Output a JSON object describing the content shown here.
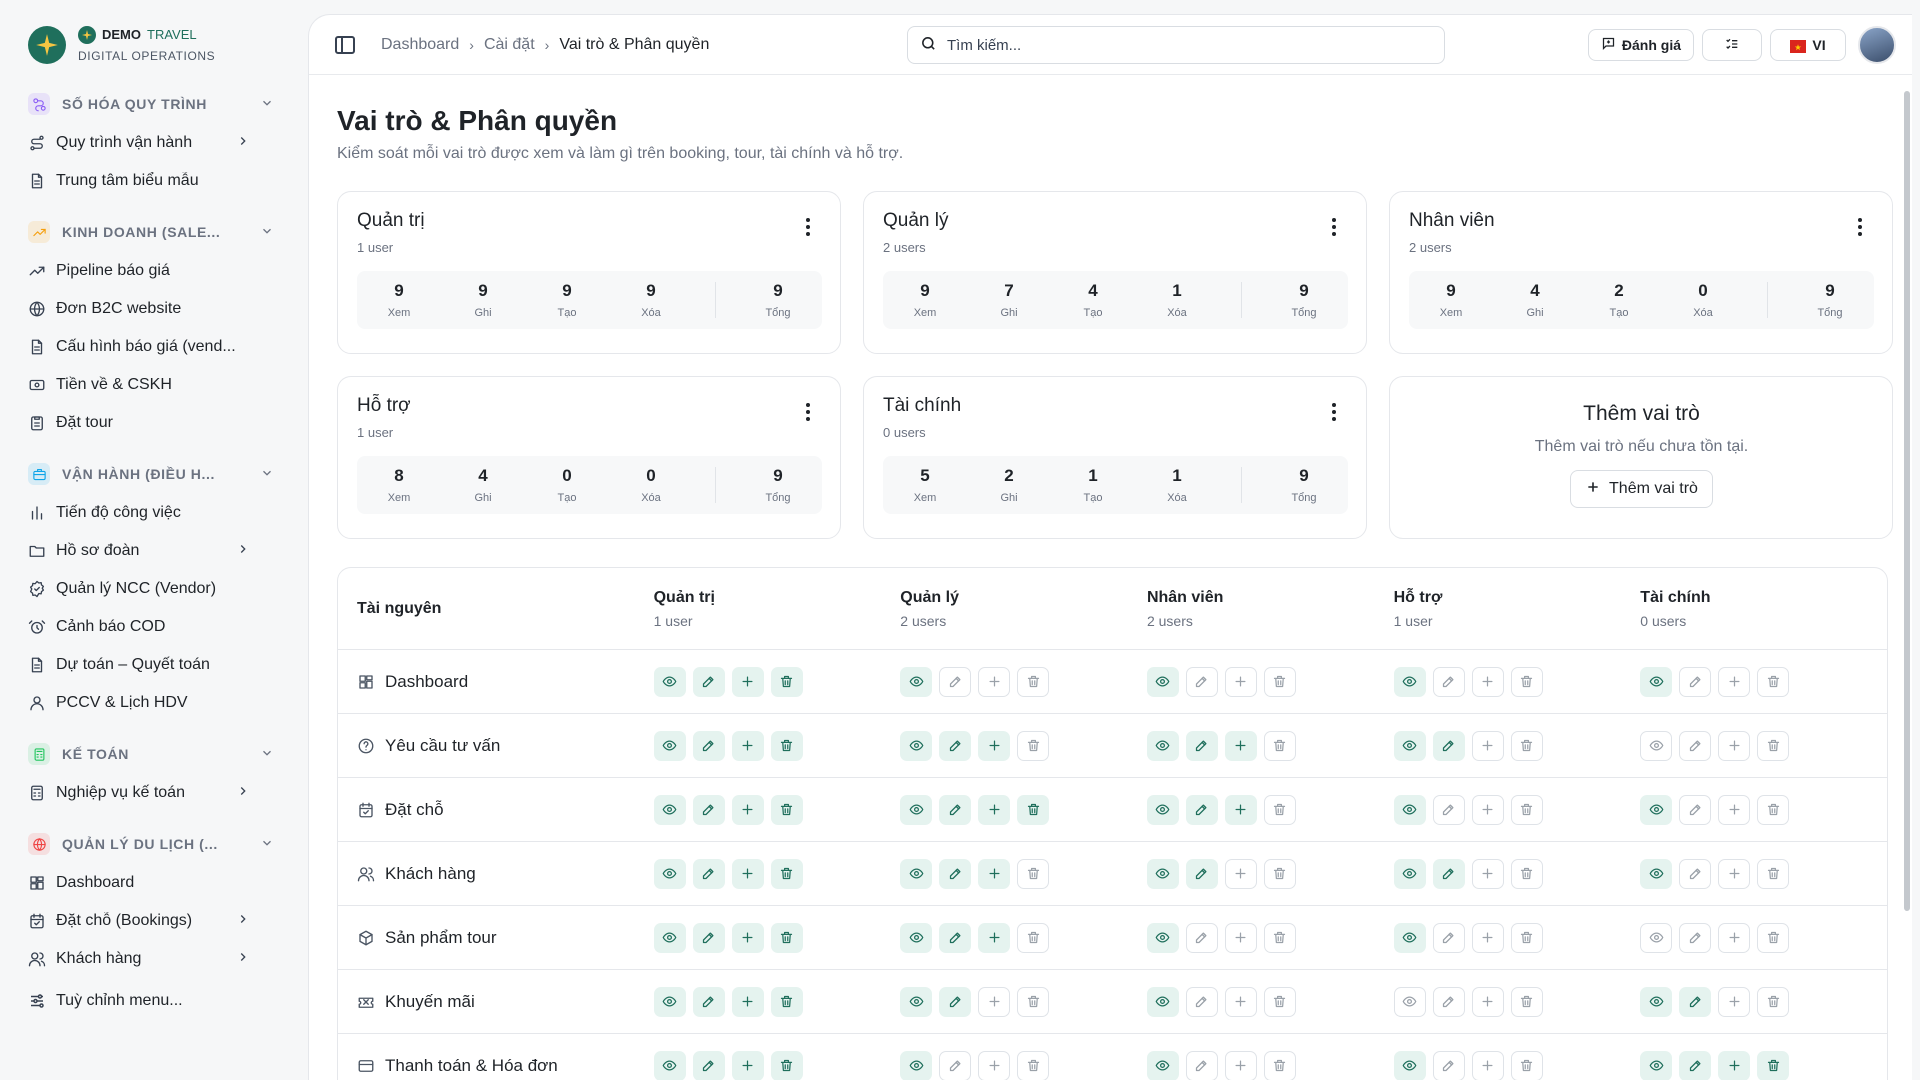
{
  "brand": {
    "name_bold": "DEMO",
    "name_light": "TRAVEL",
    "subtitle": "DIGITAL OPERATIONS"
  },
  "sidebar": {
    "sections": [
      {
        "label": "SỐ HÓA QUY TRÌNH",
        "icon": "workflow-icon",
        "color": "#8b5cf6",
        "items": [
          {
            "label": "Quy trình vận hành",
            "icon": "route-icon",
            "has_children": true
          },
          {
            "label": "Trung tâm biểu mẫu",
            "icon": "document-icon",
            "has_children": false
          }
        ]
      },
      {
        "label": "KINH DOANH (SALE...",
        "icon": "trend-icon",
        "color": "#f59e0b",
        "items": [
          {
            "label": "Pipeline báo giá",
            "icon": "trend-icon",
            "has_children": false
          },
          {
            "label": "Đơn B2C website",
            "icon": "globe-icon",
            "has_children": false
          },
          {
            "label": "Cấu hình báo giá (vend...",
            "icon": "document-icon",
            "has_children": false
          },
          {
            "label": "Tiền về & CSKH",
            "icon": "cash-icon",
            "has_children": false
          },
          {
            "label": "Đặt tour",
            "icon": "clipboard-icon",
            "has_children": false
          }
        ]
      },
      {
        "label": "VẬN HÀNH (ĐIỀU H...",
        "icon": "briefcase-icon",
        "color": "#0ea5e9",
        "items": [
          {
            "label": "Tiến độ công việc",
            "icon": "bars-icon",
            "has_children": false
          },
          {
            "label": "Hồ sơ đoàn",
            "icon": "folder-icon",
            "has_children": true
          },
          {
            "label": "Quản lý NCC (Vendor)",
            "icon": "badge-icon",
            "has_children": false
          },
          {
            "label": "Cảnh báo COD",
            "icon": "alarm-icon",
            "has_children": false
          },
          {
            "label": "Dự toán – Quyết toán",
            "icon": "document-icon",
            "has_children": false
          },
          {
            "label": "PCCV & Lịch HDV",
            "icon": "user-icon",
            "has_children": false
          }
        ]
      },
      {
        "label": "KẾ TOÁN",
        "icon": "calculator-icon",
        "color": "#22c55e",
        "items": [
          {
            "label": "Nghiệp vụ kế toán",
            "icon": "calculator-icon",
            "has_children": true
          }
        ]
      },
      {
        "label": "QUẢN LÝ DU LỊCH (...",
        "icon": "globe-icon",
        "color": "#ef4444",
        "items": [
          {
            "label": "Dashboard",
            "icon": "grid-icon",
            "has_children": false
          },
          {
            "label": "Đặt chỗ (Bookings)",
            "icon": "calendar-icon",
            "has_children": true
          },
          {
            "label": "Khách hàng",
            "icon": "users-icon",
            "has_children": true
          }
        ]
      }
    ],
    "customize_label": "Tuỳ chỉnh menu..."
  },
  "topbar": {
    "breadcrumb": [
      "Dashboard",
      "Cài đặt",
      "Vai trò & Phân quyền"
    ],
    "search_placeholder": "Tìm kiếm...",
    "feedback_label": "Đánh giá",
    "language_label": "VI"
  },
  "page": {
    "title": "Vai trò & Phân quyền",
    "subtitle": "Kiểm soát mỗi vai trò được xem và làm gì trên booking, tour, tài chính và hỗ trợ."
  },
  "stat_labels": [
    "Xem",
    "Ghi",
    "Tạo",
    "Xóa",
    "Tổng"
  ],
  "roles": [
    {
      "name": "Quản trị",
      "users": "1 user",
      "stats": [
        9,
        9,
        9,
        9
      ],
      "total": 9
    },
    {
      "name": "Quản lý",
      "users": "2 users",
      "stats": [
        9,
        7,
        4,
        1
      ],
      "total": 9
    },
    {
      "name": "Nhân viên",
      "users": "2 users",
      "stats": [
        9,
        4,
        2,
        0
      ],
      "total": 9
    },
    {
      "name": "Hỗ trợ",
      "users": "1 user",
      "stats": [
        8,
        4,
        0,
        0
      ],
      "total": 9
    },
    {
      "name": "Tài chính",
      "users": "0 users",
      "stats": [
        5,
        2,
        1,
        1
      ],
      "total": 9
    }
  ],
  "add_role": {
    "title": "Thêm vai trò",
    "description": "Thêm vai trò nếu chưa tồn tại.",
    "button": "Thêm vai trò"
  },
  "table": {
    "resource_header": "Tài nguyên",
    "rows": [
      {
        "resource": "Dashboard",
        "icon": "grid-icon",
        "perms": [
          [
            1,
            1,
            1,
            1
          ],
          [
            1,
            0,
            0,
            0
          ],
          [
            1,
            0,
            0,
            0
          ],
          [
            1,
            0,
            0,
            0
          ],
          [
            1,
            0,
            0,
            0
          ]
        ]
      },
      {
        "resource": "Yêu cầu tư vấn",
        "icon": "help-icon",
        "perms": [
          [
            1,
            1,
            1,
            1
          ],
          [
            1,
            1,
            1,
            0
          ],
          [
            1,
            1,
            1,
            0
          ],
          [
            1,
            1,
            0,
            0
          ],
          [
            0,
            0,
            0,
            0
          ]
        ]
      },
      {
        "resource": "Đặt chỗ",
        "icon": "calendar-icon",
        "perms": [
          [
            1,
            1,
            1,
            1
          ],
          [
            1,
            1,
            1,
            1
          ],
          [
            1,
            1,
            1,
            0
          ],
          [
            1,
            0,
            0,
            0
          ],
          [
            1,
            0,
            0,
            0
          ]
        ]
      },
      {
        "resource": "Khách hàng",
        "icon": "users-icon",
        "perms": [
          [
            1,
            1,
            1,
            1
          ],
          [
            1,
            1,
            1,
            0
          ],
          [
            1,
            1,
            0,
            0
          ],
          [
            1,
            1,
            0,
            0
          ],
          [
            1,
            0,
            0,
            0
          ]
        ]
      },
      {
        "resource": "Sản phẩm tour",
        "icon": "box-icon",
        "perms": [
          [
            1,
            1,
            1,
            1
          ],
          [
            1,
            1,
            1,
            0
          ],
          [
            1,
            0,
            0,
            0
          ],
          [
            1,
            0,
            0,
            0
          ],
          [
            0,
            0,
            0,
            0
          ]
        ]
      },
      {
        "resource": "Khuyến mãi",
        "icon": "ticket-icon",
        "perms": [
          [
            1,
            1,
            1,
            1
          ],
          [
            1,
            1,
            0,
            0
          ],
          [
            1,
            0,
            0,
            0
          ],
          [
            0,
            0,
            0,
            0
          ],
          [
            1,
            1,
            0,
            0
          ]
        ]
      },
      {
        "resource": "Thanh toán & Hóa đơn",
        "icon": "card-icon",
        "perms": [
          [
            1,
            1,
            1,
            1
          ],
          [
            1,
            0,
            0,
            0
          ],
          [
            1,
            0,
            0,
            0
          ],
          [
            1,
            0,
            0,
            0
          ],
          [
            1,
            1,
            1,
            1
          ]
        ]
      }
    ]
  },
  "colors": {
    "accent": "#1f6f5c",
    "accent_soft": "#e5f3ef"
  }
}
